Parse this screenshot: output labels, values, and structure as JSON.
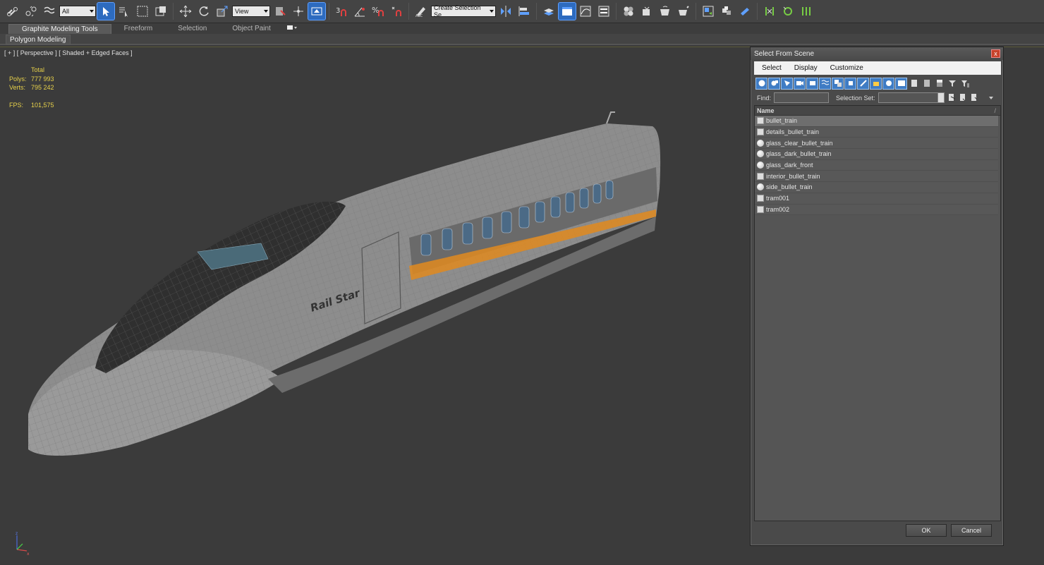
{
  "toolbar": {
    "filter_value": "All",
    "refcoord_value": "View",
    "selection_set_value": "Create Selection Se"
  },
  "ribbon": {
    "tabs": [
      "Graphite Modeling Tools",
      "Freeform",
      "Selection",
      "Object Paint"
    ],
    "panel_label": "Polygon Modeling"
  },
  "viewport": {
    "label": "[ + ] [ Perspective ] [ Shaded + Edged Faces ]",
    "stats": {
      "total_label": "Total",
      "polys_label": "Polys:",
      "polys_value": "777 993",
      "verts_label": "Verts:",
      "verts_value": "795 242",
      "fps_label": "FPS:",
      "fps_value": "101,575"
    },
    "model_text": "Rail Star"
  },
  "dialog": {
    "title": "Select From Scene",
    "close_label": "x",
    "menu": [
      "Select",
      "Display",
      "Customize"
    ],
    "find_label": "Find:",
    "selection_set_label": "Selection Set:",
    "column_header": "Name",
    "sort_glyph": "/",
    "items": [
      {
        "name": "bullet_train",
        "icon": "mesh"
      },
      {
        "name": "details_bullet_train",
        "icon": "mesh"
      },
      {
        "name": "glass_clear_bullet_train",
        "icon": "sphere"
      },
      {
        "name": "glass_dark_bullet_train",
        "icon": "sphere"
      },
      {
        "name": "glass_dark_front",
        "icon": "sphere"
      },
      {
        "name": "interior_bullet_train",
        "icon": "mesh"
      },
      {
        "name": "side_bullet_train",
        "icon": "sphere"
      },
      {
        "name": "tram001",
        "icon": "mesh"
      },
      {
        "name": "tram002",
        "icon": "mesh"
      }
    ],
    "ok_label": "OK",
    "cancel_label": "Cancel"
  },
  "colors": {
    "accent_blue": "#2d6bbf",
    "stats_yellow": "#e6d04a",
    "stripe_orange": "#e08a1e"
  }
}
